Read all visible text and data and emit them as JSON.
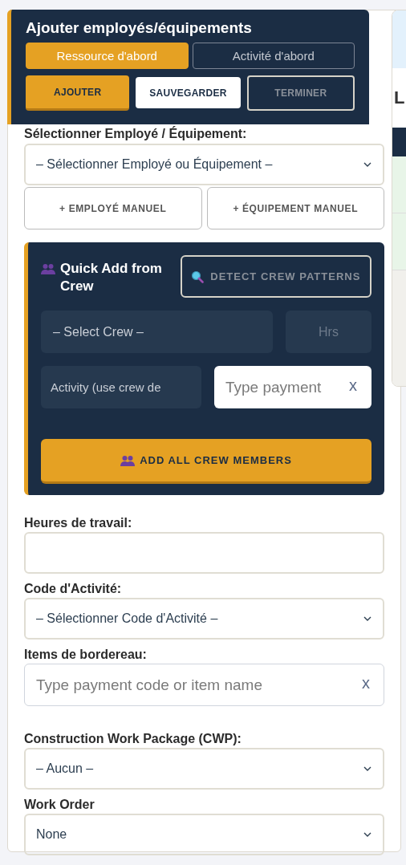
{
  "header": {
    "title": "Ajouter employés/équipements",
    "mode_tabs": [
      {
        "label": "Ressource d'abord",
        "selected": true
      },
      {
        "label": "Activité d'abord",
        "selected": false
      }
    ],
    "actions": [
      {
        "label": "AJOUTER",
        "kind": "primary"
      },
      {
        "label": "SAUVEGARDER",
        "kind": "light"
      },
      {
        "label": "TERMINER",
        "kind": "outline"
      }
    ]
  },
  "employee_select": {
    "label": "Sélectionner Employé / Équipement:",
    "value": "– Sélectionner Employé ou Équipement –"
  },
  "manual_buttons": [
    "+ EMPLOYÉ MANUEL",
    "+ ÉQUIPEMENT MANUEL"
  ],
  "crew": {
    "title": "Quick Add from Crew",
    "detect_button": "DETECT CREW PATTERNS",
    "crew_select": "– Select Crew –",
    "hours_placeholder": "Hrs",
    "activity_select": "Activity (use crew de",
    "payment_placeholder": "Type payment",
    "clear": "x",
    "add_button": "ADD ALL CREW MEMBERS"
  },
  "fields": [
    {
      "kind": "text",
      "label": "Heures de travail:"
    },
    {
      "kind": "select",
      "label": "Code d'Activité:",
      "value": "– Sélectionner Code d'Activité –"
    },
    {
      "kind": "search",
      "label": "Items de bordereau:",
      "placeholder": "Type payment code or item name",
      "clear": "x"
    },
    {
      "kind": "select",
      "label": "Construction Work Package (CWP):",
      "value": "– Aucun –"
    },
    {
      "kind": "select",
      "label": "Work Order",
      "value": "None"
    }
  ],
  "side_panel": {
    "heading": "L"
  }
}
